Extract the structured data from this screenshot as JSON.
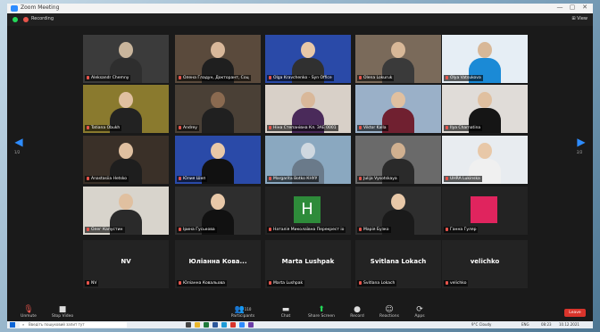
{
  "window": {
    "title": "Zoom Meeting",
    "minimize": "—",
    "maximize": "▢",
    "close": "✕"
  },
  "status": {
    "recording": "Recording",
    "view": "⊞ View"
  },
  "tiles": [
    {
      "name": "Aleksandr Chemny",
      "type": "video",
      "active": false
    },
    {
      "name": "Олена Гладун, Докторант, Соц",
      "type": "video",
      "active": false
    },
    {
      "name": "Olga Kravchenko - Syn Office",
      "type": "video",
      "active": false
    },
    {
      "name": "Olena Lokuruk",
      "type": "video",
      "active": false
    },
    {
      "name": "Olya Vatsukova",
      "type": "video",
      "active": false
    },
    {
      "name": "Tatiana Obukh",
      "type": "video",
      "active": true
    },
    {
      "name": "Andrey",
      "type": "video",
      "active": false
    },
    {
      "name": "Ніна Степанівна Кл. ЗАЕ 0001",
      "type": "video",
      "active": false
    },
    {
      "name": "Viktor Kalla",
      "type": "video",
      "active": false
    },
    {
      "name": "Ilya Charnatina",
      "type": "video",
      "active": false
    },
    {
      "name": "Anastasiia Hetsko",
      "type": "video",
      "active": false
    },
    {
      "name": "Юлия Шеп",
      "type": "video",
      "active": false
    },
    {
      "name": "Margarita Botko КНУУ",
      "type": "video",
      "active": false
    },
    {
      "name": "Julija Vysotskaya",
      "type": "video",
      "active": false
    },
    {
      "name": "UHRA Lukinska",
      "type": "video",
      "active": false
    },
    {
      "name": "Олег Капустин",
      "type": "video",
      "active": false
    },
    {
      "name": "Ірина Гуськова",
      "type": "video",
      "active": false
    },
    {
      "name": "Наталія Миколаївна Перекрест іо",
      "type": "initial",
      "initial": "H",
      "active": false
    },
    {
      "name": "Марія Бузко",
      "type": "video",
      "active": false
    },
    {
      "name": "Ганна Гуляр",
      "type": "pink",
      "active": false
    },
    {
      "name": "NV",
      "type": "text",
      "big": "NV",
      "active": false
    },
    {
      "name": "Юліанна Ковальова",
      "type": "text",
      "big": "Юліанна Кова...",
      "active": false
    },
    {
      "name": "Marta Lushpak",
      "type": "text",
      "big": "Marta Lushpak",
      "active": false
    },
    {
      "name": "Svitlana Lokach",
      "type": "text",
      "big": "Svitlana Lokach",
      "active": false
    },
    {
      "name": "velichko",
      "type": "text",
      "big": "velichko",
      "active": false
    }
  ],
  "pager": {
    "prev": "◀",
    "next": "▶",
    "prev_label": "1/2",
    "next_label": "2/2"
  },
  "toolbar": {
    "unmute": {
      "icon": "mic-muted-icon",
      "label": "Unmute"
    },
    "stop_video": {
      "icon": "video-camera-icon",
      "label": "Stop Video"
    },
    "participants": {
      "icon": "participants-icon",
      "label": "Participants",
      "count": "110"
    },
    "chat": {
      "icon": "chat-icon",
      "label": "Chat"
    },
    "share": {
      "icon": "share-screen-icon",
      "label": "Share Screen"
    },
    "record": {
      "icon": "record-icon",
      "label": "Record"
    },
    "reactions": {
      "icon": "reactions-icon",
      "label": "Reactions"
    },
    "apps": {
      "icon": "apps-icon",
      "label": "Apps"
    },
    "leave": "Leave"
  },
  "taskbar": {
    "search_placeholder": "Введіть пошуковий запит тут",
    "weather": "9°C Cloudy",
    "lang": "ENG",
    "time": "08:23",
    "date": "10.12.2021"
  }
}
